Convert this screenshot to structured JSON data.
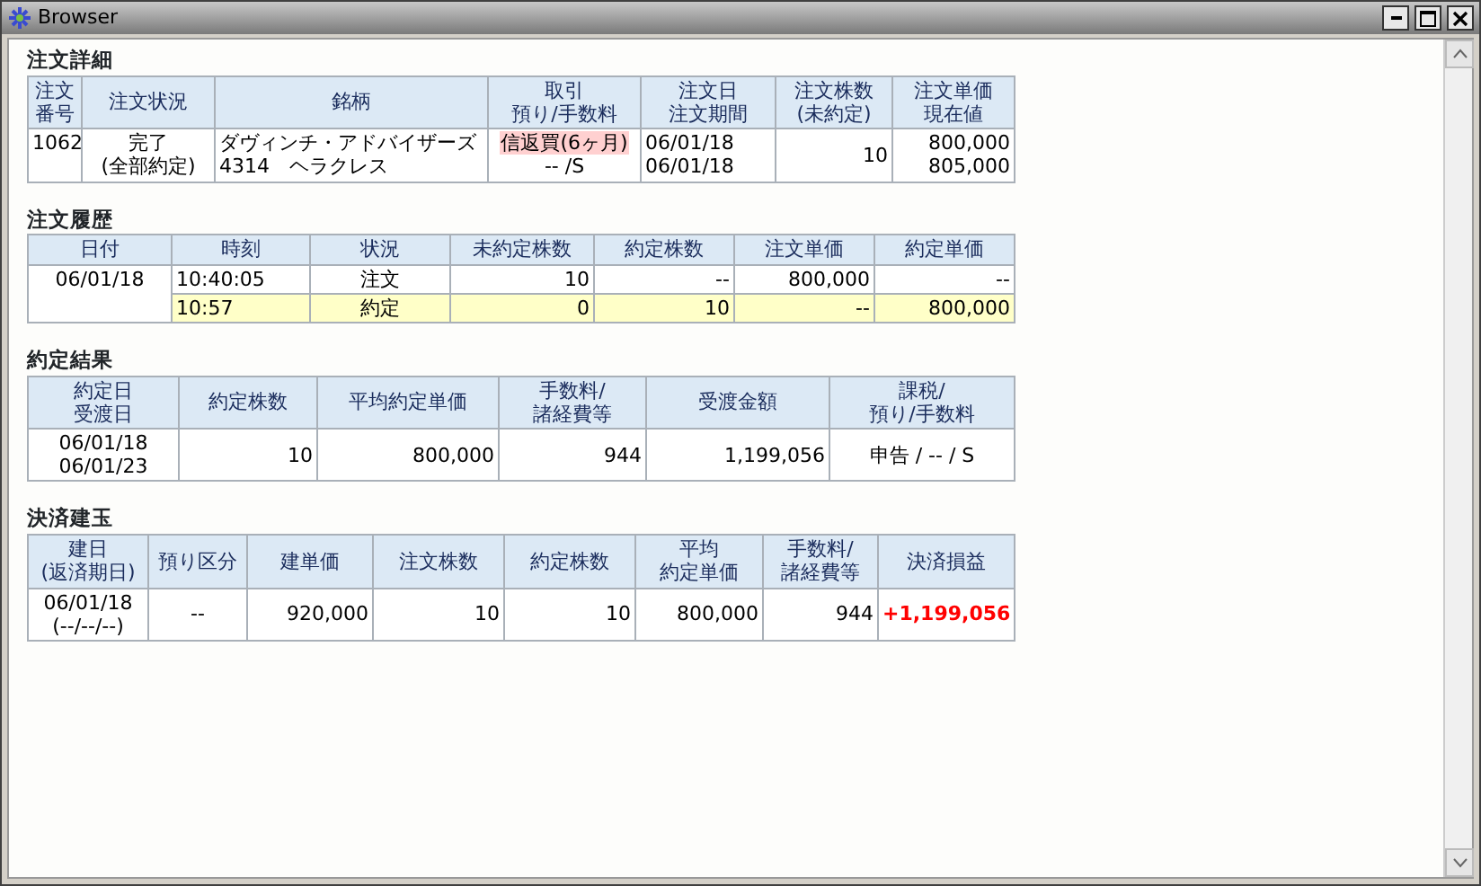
{
  "window": {
    "title": "Browser"
  },
  "sections": [
    {
      "title": "注文詳細",
      "columns": [
        {
          "lines": [
            "注文",
            "番号"
          ]
        },
        {
          "lines": [
            "注文状況"
          ]
        },
        {
          "lines": [
            "銘柄"
          ]
        },
        {
          "lines": [
            "取引",
            "預り/手数料"
          ]
        },
        {
          "lines": [
            "注文日",
            "注文期間"
          ]
        },
        {
          "lines": [
            "注文株数",
            "(未約定)"
          ]
        },
        {
          "lines": [
            "注文単価",
            "現在値"
          ]
        }
      ],
      "rows": [
        {
          "highlighted": false,
          "cells": [
            {
              "lines": [
                "1062"
              ]
            },
            {
              "lines": [
                "完了",
                "(全部約定)"
              ]
            },
            {
              "lines": [
                "ダヴィンチ・アドバイザーズ",
                "4314　ヘラクレス"
              ]
            },
            {
              "lines": [
                {
                  "text": "信返買(6ヶ月)",
                  "tagged": true
                },
                "-- /S"
              ]
            },
            {
              "lines": [
                "06/01/18",
                "06/01/18"
              ]
            },
            {
              "lines": [
                "10"
              ]
            },
            {
              "lines": [
                "800,000",
                "805,000"
              ]
            }
          ]
        }
      ]
    },
    {
      "title": "注文履歴",
      "columns": [
        {
          "lines": [
            "日付"
          ]
        },
        {
          "lines": [
            "時刻"
          ]
        },
        {
          "lines": [
            "状況"
          ]
        },
        {
          "lines": [
            "未約定株数"
          ]
        },
        {
          "lines": [
            "約定株数"
          ]
        },
        {
          "lines": [
            "注文単価"
          ]
        },
        {
          "lines": [
            "約定単価"
          ]
        }
      ],
      "rows": [
        {
          "highlighted": false,
          "cells": [
            {
              "lines": [
                "06/01/18"
              ],
              "rowspan": 2
            },
            {
              "lines": [
                "10:40:05"
              ]
            },
            {
              "lines": [
                "注文"
              ]
            },
            {
              "lines": [
                "10"
              ]
            },
            {
              "lines": [
                "--"
              ]
            },
            {
              "lines": [
                "800,000"
              ]
            },
            {
              "lines": [
                "--"
              ]
            }
          ]
        },
        {
          "highlighted": true,
          "cells": [
            {
              "lines": [
                "10:57"
              ]
            },
            {
              "lines": [
                "約定"
              ]
            },
            {
              "lines": [
                "0"
              ]
            },
            {
              "lines": [
                "10"
              ]
            },
            {
              "lines": [
                "--"
              ]
            },
            {
              "lines": [
                "800,000"
              ]
            }
          ]
        }
      ]
    },
    {
      "title": "約定結果",
      "columns": [
        {
          "lines": [
            "約定日",
            "受渡日"
          ]
        },
        {
          "lines": [
            "約定株数"
          ]
        },
        {
          "lines": [
            "平均約定単価"
          ]
        },
        {
          "lines": [
            "手数料/",
            "諸経費等"
          ]
        },
        {
          "lines": [
            "受渡金額"
          ]
        },
        {
          "lines": [
            "課税/",
            "預り/手数料"
          ]
        }
      ],
      "rows": [
        {
          "highlighted": false,
          "cells": [
            {
              "lines": [
                "06/01/18",
                "06/01/23"
              ]
            },
            {
              "lines": [
                "10"
              ]
            },
            {
              "lines": [
                "800,000"
              ]
            },
            {
              "lines": [
                "944"
              ]
            },
            {
              "lines": [
                "1,199,056"
              ]
            },
            {
              "lines": [
                "申告 / -- / S"
              ]
            }
          ]
        }
      ]
    },
    {
      "title": "決済建玉",
      "columns": [
        {
          "lines": [
            "建日",
            "(返済期日)"
          ]
        },
        {
          "lines": [
            "預り区分"
          ]
        },
        {
          "lines": [
            "建単価"
          ]
        },
        {
          "lines": [
            "注文株数"
          ]
        },
        {
          "lines": [
            "約定株数"
          ]
        },
        {
          "lines": [
            "平均",
            "約定単価"
          ]
        },
        {
          "lines": [
            "手数料/",
            "諸経費等"
          ]
        },
        {
          "lines": [
            "決済損益"
          ]
        }
      ],
      "rows": [
        {
          "highlighted": false,
          "cells": [
            {
              "lines": [
                "06/01/18",
                "(--/--/--)"
              ]
            },
            {
              "lines": [
                "--"
              ]
            },
            {
              "lines": [
                "920,000"
              ]
            },
            {
              "lines": [
                "10"
              ]
            },
            {
              "lines": [
                "10"
              ]
            },
            {
              "lines": [
                "800,000"
              ]
            },
            {
              "lines": [
                "944"
              ]
            },
            {
              "lines": [
                "+1,199,056"
              ],
              "kind": "gain"
            }
          ]
        }
      ]
    }
  ]
}
